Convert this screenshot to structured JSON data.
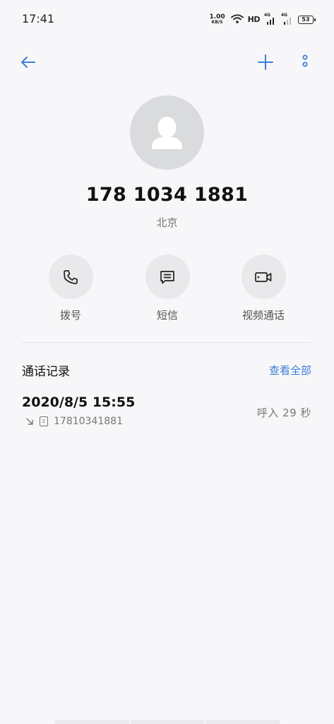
{
  "status_bar": {
    "time": "17:41",
    "net_speed_value": "1.00",
    "net_speed_unit": "KB/S",
    "hd_label": "HD",
    "sim1_label": "4G",
    "sim2_label": "4G",
    "battery": "53"
  },
  "top_bar": {
    "back_icon": "arrow-left-icon",
    "add_icon": "plus-icon",
    "more_icon": "more-vertical-icon",
    "accent_color": "#3b7fd6"
  },
  "contact": {
    "number": "178 1034 1881",
    "location": "北京"
  },
  "actions": [
    {
      "label": "拨号",
      "icon": "phone-icon"
    },
    {
      "label": "短信",
      "icon": "message-icon"
    },
    {
      "label": "视频通话",
      "icon": "video-call-icon"
    }
  ],
  "call_log": {
    "title": "通话记录",
    "view_all": "查看全部",
    "entries": [
      {
        "datetime": "2020/8/5 15:55",
        "direction_icon": "incoming-arrow-icon",
        "sim": "2",
        "number": "17810341881",
        "result": "呼入  29 秒"
      }
    ]
  }
}
